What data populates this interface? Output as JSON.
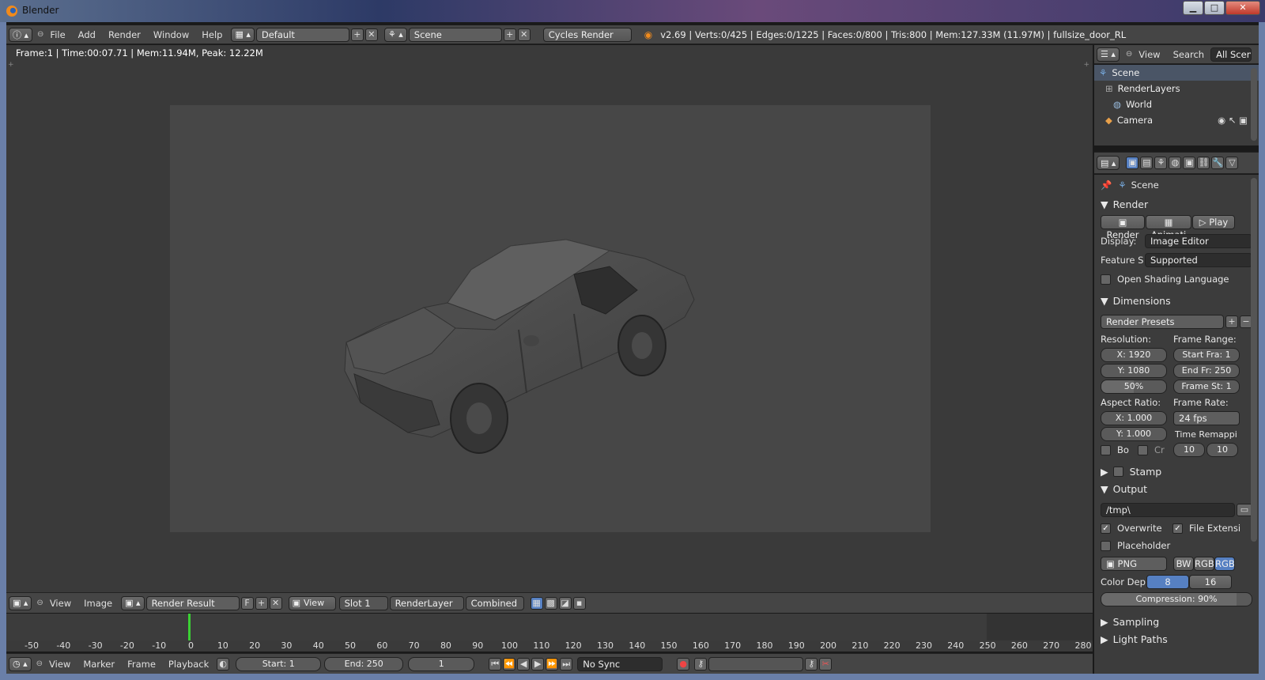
{
  "window": {
    "title": "Blender",
    "min": "▁",
    "max": "□",
    "close": "✕"
  },
  "info_header": {
    "menus": [
      "File",
      "Add",
      "Render",
      "Window",
      "Help"
    ],
    "layout": "Default",
    "scene": "Scene",
    "engine": "Cycles Render",
    "stats": "v2.69 | Verts:0/425 | Edges:0/1225 | Faces:0/800 | Tris:800 | Mem:127.33M (11.97M) | fullsize_door_RL"
  },
  "editor": {
    "info": "Frame:1 | Time:00:07.71 | Mem:11.94M, Peak: 12.22M"
  },
  "image_header": {
    "menus": [
      "View",
      "Image"
    ],
    "image": "Render Result",
    "f_label": "F",
    "view": "View",
    "slot": "Slot 1",
    "layer": "RenderLayer",
    "pass": "Combined"
  },
  "timeline": {
    "ticks": [
      "-50",
      "-40",
      "-30",
      "-20",
      "-10",
      "0",
      "10",
      "20",
      "30",
      "40",
      "50",
      "60",
      "70",
      "80",
      "90",
      "100",
      "110",
      "120",
      "130",
      "140",
      "150",
      "160",
      "170",
      "180",
      "190",
      "200",
      "210",
      "220",
      "230",
      "240",
      "250",
      "260",
      "270",
      "280"
    ],
    "menus": [
      "View",
      "Marker",
      "Frame",
      "Playback"
    ],
    "start": "Start: 1",
    "end": "End: 250",
    "current": "1",
    "sync": "No Sync"
  },
  "outliner": {
    "menus": [
      "View",
      "Search"
    ],
    "filter": "All Scene",
    "items": [
      "Scene",
      "RenderLayers",
      "World",
      "Camera"
    ]
  },
  "properties": {
    "context": "Scene",
    "render": {
      "title": "Render",
      "render_btn": "Render",
      "anim_btn": "Animati",
      "play_btn": "Play",
      "display_label": "Display:",
      "display_value": "Image Editor",
      "feature_label": "Feature S",
      "feature_value": "Supported",
      "osl": "Open Shading Language"
    },
    "dimensions": {
      "title": "Dimensions",
      "presets": "Render Presets",
      "resolution_label": "Resolution:",
      "res_x": "X: 1920",
      "res_y": "Y: 1080",
      "res_pct": "50%",
      "frame_range_label": "Frame Range:",
      "start_fra": "Start Fra: 1",
      "end_fr": "End Fr: 250",
      "frame_st": "Frame St: 1",
      "aspect_label": "Aspect Ratio:",
      "asp_x": "X: 1.000",
      "asp_y": "Y: 1.000",
      "frame_rate_label": "Frame Rate:",
      "fps": "24 fps",
      "remap_label": "Time Remappi",
      "remap_old": "10",
      "remap_new": "10",
      "bo": "Bo",
      "cr": "Cr"
    },
    "stamp": "Stamp",
    "output": {
      "title": "Output",
      "path": "/tmp\\",
      "overwrite": "Overwrite",
      "file_ext": "File Extensi",
      "placeholder": "Placeholder",
      "format": "PNG",
      "bw": "BW",
      "rgb": "RGB",
      "rgba": "RGB",
      "color_depth_label": "Color Dep",
      "depth8": "8",
      "depth16": "16",
      "compression": "Compression: 90%"
    },
    "sampling": "Sampling",
    "light_paths": "Light Paths"
  }
}
